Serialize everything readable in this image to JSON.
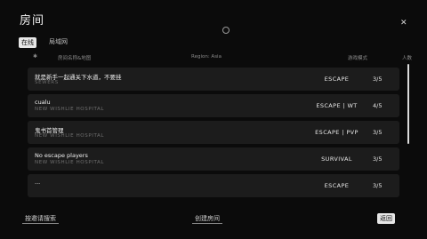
{
  "window": {
    "title": "房间",
    "close_icon": "close-icon",
    "center_icon": "refresh-icon"
  },
  "tabs": [
    {
      "label": "在线"
    },
    {
      "label": "局域网"
    }
  ],
  "header": {
    "star": "✱",
    "name": "房间名称&地图",
    "region": "Region: Asia",
    "mode": "游戏模式",
    "count": "人数"
  },
  "rooms": [
    {
      "name": "就是新手一起通关下水道，不要挂",
      "map": "SEWERS",
      "mode": "ESCAPE",
      "count": "3/5"
    },
    {
      "name": "cualu",
      "map": "NEW WISHLIE HOSPITAL",
      "mode": "ESCAPE | WT",
      "count": "4/5"
    },
    {
      "name": "鬼书首管理",
      "map": "NEW WISHLIE HOSPITAL",
      "mode": "ESCAPE | PVP",
      "count": "3/5"
    },
    {
      "name": "No escape players",
      "map": "NEW WISHLIE HOSPITAL",
      "mode": "SURVIVAL",
      "count": "3/5"
    },
    {
      "name": "...",
      "map": "",
      "mode": "ESCAPE",
      "count": "3/5"
    }
  ],
  "footer": {
    "left_button": "按邀请搜索",
    "center_button": "创建房间",
    "right_button": "返回"
  }
}
